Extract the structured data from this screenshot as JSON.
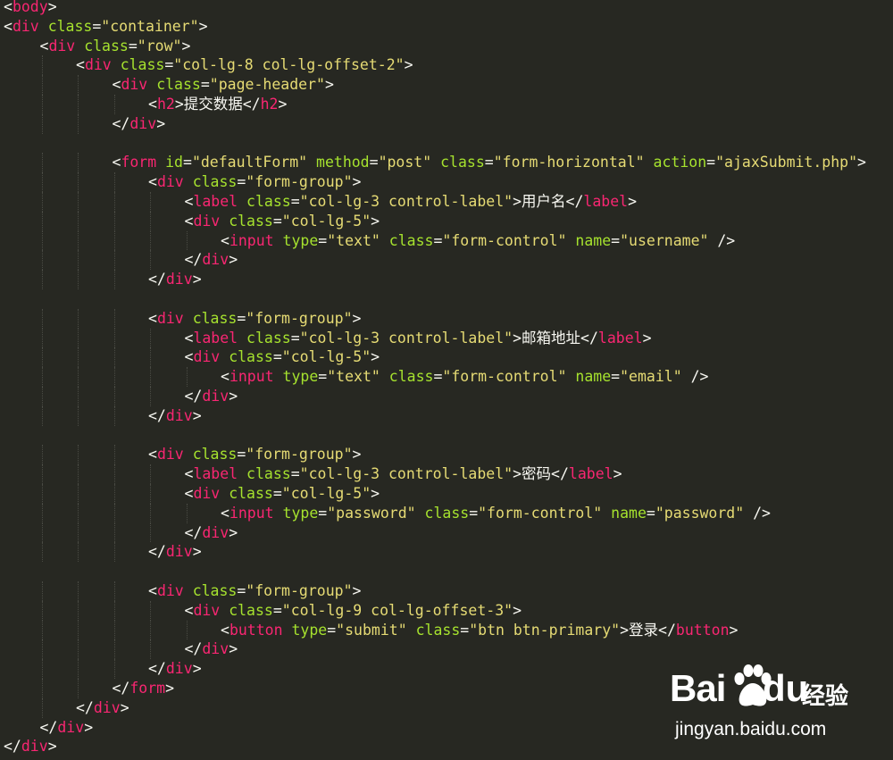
{
  "editor": {
    "theme": "monokai",
    "colors": {
      "background": "#272822",
      "tag": "#f92672",
      "attribute": "#a6e22e",
      "string": "#e6db74",
      "text": "#f8f8f2"
    },
    "lines": [
      {
        "indent": 0,
        "tokens": [
          [
            "p",
            "<"
          ],
          [
            "tag",
            "body"
          ],
          [
            "p",
            ">"
          ]
        ]
      },
      {
        "indent": 0,
        "tokens": [
          [
            "p",
            "<"
          ],
          [
            "tag",
            "div"
          ],
          [
            "p",
            " "
          ],
          [
            "attr",
            "class"
          ],
          [
            "p",
            "="
          ],
          [
            "str",
            "\"container\""
          ],
          [
            "p",
            ">"
          ]
        ]
      },
      {
        "indent": 1,
        "tokens": [
          [
            "p",
            "<"
          ],
          [
            "tag",
            "div"
          ],
          [
            "p",
            " "
          ],
          [
            "attr",
            "class"
          ],
          [
            "p",
            "="
          ],
          [
            "str",
            "\"row\""
          ],
          [
            "p",
            ">"
          ]
        ]
      },
      {
        "indent": 2,
        "tokens": [
          [
            "p",
            "<"
          ],
          [
            "tag",
            "div"
          ],
          [
            "p",
            " "
          ],
          [
            "attr",
            "class"
          ],
          [
            "p",
            "="
          ],
          [
            "str",
            "\"col-lg-8 col-lg-offset-2\""
          ],
          [
            "p",
            ">"
          ]
        ]
      },
      {
        "indent": 3,
        "tokens": [
          [
            "p",
            "<"
          ],
          [
            "tag",
            "div"
          ],
          [
            "p",
            " "
          ],
          [
            "attr",
            "class"
          ],
          [
            "p",
            "="
          ],
          [
            "str",
            "\"page-header\""
          ],
          [
            "p",
            ">"
          ]
        ]
      },
      {
        "indent": 4,
        "tokens": [
          [
            "p",
            "<"
          ],
          [
            "tag",
            "h2"
          ],
          [
            "p",
            ">"
          ],
          [
            "text",
            "提交数据"
          ],
          [
            "p",
            "</"
          ],
          [
            "tag",
            "h2"
          ],
          [
            "p",
            ">"
          ]
        ]
      },
      {
        "indent": 3,
        "tokens": [
          [
            "p",
            "</"
          ],
          [
            "tag",
            "div"
          ],
          [
            "p",
            ">"
          ]
        ]
      },
      {
        "indent": 0,
        "tokens": []
      },
      {
        "indent": 3,
        "tokens": [
          [
            "p",
            "<"
          ],
          [
            "tag",
            "form"
          ],
          [
            "p",
            " "
          ],
          [
            "attr",
            "id"
          ],
          [
            "p",
            "="
          ],
          [
            "str",
            "\"defaultForm\""
          ],
          [
            "p",
            " "
          ],
          [
            "attr",
            "method"
          ],
          [
            "p",
            "="
          ],
          [
            "str",
            "\"post\""
          ],
          [
            "p",
            " "
          ],
          [
            "attr",
            "class"
          ],
          [
            "p",
            "="
          ],
          [
            "str",
            "\"form-horizontal\""
          ],
          [
            "p",
            " "
          ],
          [
            "attr",
            "action"
          ],
          [
            "p",
            "="
          ],
          [
            "str",
            "\"ajaxSubmit.php\""
          ],
          [
            "p",
            ">"
          ]
        ]
      },
      {
        "indent": 4,
        "tokens": [
          [
            "p",
            "<"
          ],
          [
            "tag",
            "div"
          ],
          [
            "p",
            " "
          ],
          [
            "attr",
            "class"
          ],
          [
            "p",
            "="
          ],
          [
            "str",
            "\"form-group\""
          ],
          [
            "p",
            ">"
          ]
        ]
      },
      {
        "indent": 5,
        "tokens": [
          [
            "p",
            "<"
          ],
          [
            "tag",
            "label"
          ],
          [
            "p",
            " "
          ],
          [
            "attr",
            "class"
          ],
          [
            "p",
            "="
          ],
          [
            "str",
            "\"col-lg-3 control-label\""
          ],
          [
            "p",
            ">"
          ],
          [
            "text",
            "用户名"
          ],
          [
            "p",
            "</"
          ],
          [
            "tag",
            "label"
          ],
          [
            "p",
            ">"
          ]
        ]
      },
      {
        "indent": 5,
        "tokens": [
          [
            "p",
            "<"
          ],
          [
            "tag",
            "div"
          ],
          [
            "p",
            " "
          ],
          [
            "attr",
            "class"
          ],
          [
            "p",
            "="
          ],
          [
            "str",
            "\"col-lg-5\""
          ],
          [
            "p",
            ">"
          ]
        ]
      },
      {
        "indent": 6,
        "tokens": [
          [
            "p",
            "<"
          ],
          [
            "tag",
            "input"
          ],
          [
            "p",
            " "
          ],
          [
            "attr",
            "type"
          ],
          [
            "p",
            "="
          ],
          [
            "str",
            "\"text\""
          ],
          [
            "p",
            " "
          ],
          [
            "attr",
            "class"
          ],
          [
            "p",
            "="
          ],
          [
            "str",
            "\"form-control\""
          ],
          [
            "p",
            " "
          ],
          [
            "attr",
            "name"
          ],
          [
            "p",
            "="
          ],
          [
            "str",
            "\"username\""
          ],
          [
            "p",
            " />"
          ]
        ]
      },
      {
        "indent": 5,
        "tokens": [
          [
            "p",
            "</"
          ],
          [
            "tag",
            "div"
          ],
          [
            "p",
            ">"
          ]
        ]
      },
      {
        "indent": 4,
        "tokens": [
          [
            "p",
            "</"
          ],
          [
            "tag",
            "div"
          ],
          [
            "p",
            ">"
          ]
        ]
      },
      {
        "indent": 0,
        "tokens": []
      },
      {
        "indent": 4,
        "tokens": [
          [
            "p",
            "<"
          ],
          [
            "tag",
            "div"
          ],
          [
            "p",
            " "
          ],
          [
            "attr",
            "class"
          ],
          [
            "p",
            "="
          ],
          [
            "str",
            "\"form-group\""
          ],
          [
            "p",
            ">"
          ]
        ]
      },
      {
        "indent": 5,
        "tokens": [
          [
            "p",
            "<"
          ],
          [
            "tag",
            "label"
          ],
          [
            "p",
            " "
          ],
          [
            "attr",
            "class"
          ],
          [
            "p",
            "="
          ],
          [
            "str",
            "\"col-lg-3 control-label\""
          ],
          [
            "p",
            ">"
          ],
          [
            "text",
            "邮箱地址"
          ],
          [
            "p",
            "</"
          ],
          [
            "tag",
            "label"
          ],
          [
            "p",
            ">"
          ]
        ]
      },
      {
        "indent": 5,
        "tokens": [
          [
            "p",
            "<"
          ],
          [
            "tag",
            "div"
          ],
          [
            "p",
            " "
          ],
          [
            "attr",
            "class"
          ],
          [
            "p",
            "="
          ],
          [
            "str",
            "\"col-lg-5\""
          ],
          [
            "p",
            ">"
          ]
        ]
      },
      {
        "indent": 6,
        "tokens": [
          [
            "p",
            "<"
          ],
          [
            "tag",
            "input"
          ],
          [
            "p",
            " "
          ],
          [
            "attr",
            "type"
          ],
          [
            "p",
            "="
          ],
          [
            "str",
            "\"text\""
          ],
          [
            "p",
            " "
          ],
          [
            "attr",
            "class"
          ],
          [
            "p",
            "="
          ],
          [
            "str",
            "\"form-control\""
          ],
          [
            "p",
            " "
          ],
          [
            "attr",
            "name"
          ],
          [
            "p",
            "="
          ],
          [
            "str",
            "\"email\""
          ],
          [
            "p",
            " />"
          ]
        ]
      },
      {
        "indent": 5,
        "tokens": [
          [
            "p",
            "</"
          ],
          [
            "tag",
            "div"
          ],
          [
            "p",
            ">"
          ]
        ]
      },
      {
        "indent": 4,
        "tokens": [
          [
            "p",
            "</"
          ],
          [
            "tag",
            "div"
          ],
          [
            "p",
            ">"
          ]
        ]
      },
      {
        "indent": 0,
        "tokens": []
      },
      {
        "indent": 4,
        "tokens": [
          [
            "p",
            "<"
          ],
          [
            "tag",
            "div"
          ],
          [
            "p",
            " "
          ],
          [
            "attr",
            "class"
          ],
          [
            "p",
            "="
          ],
          [
            "str",
            "\"form-group\""
          ],
          [
            "p",
            ">"
          ]
        ]
      },
      {
        "indent": 5,
        "tokens": [
          [
            "p",
            "<"
          ],
          [
            "tag",
            "label"
          ],
          [
            "p",
            " "
          ],
          [
            "attr",
            "class"
          ],
          [
            "p",
            "="
          ],
          [
            "str",
            "\"col-lg-3 control-label\""
          ],
          [
            "p",
            ">"
          ],
          [
            "text",
            "密码"
          ],
          [
            "p",
            "</"
          ],
          [
            "tag",
            "label"
          ],
          [
            "p",
            ">"
          ]
        ]
      },
      {
        "indent": 5,
        "tokens": [
          [
            "p",
            "<"
          ],
          [
            "tag",
            "div"
          ],
          [
            "p",
            " "
          ],
          [
            "attr",
            "class"
          ],
          [
            "p",
            "="
          ],
          [
            "str",
            "\"col-lg-5\""
          ],
          [
            "p",
            ">"
          ]
        ]
      },
      {
        "indent": 6,
        "tokens": [
          [
            "p",
            "<"
          ],
          [
            "tag",
            "input"
          ],
          [
            "p",
            " "
          ],
          [
            "attr",
            "type"
          ],
          [
            "p",
            "="
          ],
          [
            "str",
            "\"password\""
          ],
          [
            "p",
            " "
          ],
          [
            "attr",
            "class"
          ],
          [
            "p",
            "="
          ],
          [
            "str",
            "\"form-control\""
          ],
          [
            "p",
            " "
          ],
          [
            "attr",
            "name"
          ],
          [
            "p",
            "="
          ],
          [
            "str",
            "\"password\""
          ],
          [
            "p",
            " />"
          ]
        ]
      },
      {
        "indent": 5,
        "tokens": [
          [
            "p",
            "</"
          ],
          [
            "tag",
            "div"
          ],
          [
            "p",
            ">"
          ]
        ]
      },
      {
        "indent": 4,
        "tokens": [
          [
            "p",
            "</"
          ],
          [
            "tag",
            "div"
          ],
          [
            "p",
            ">"
          ]
        ]
      },
      {
        "indent": 0,
        "tokens": []
      },
      {
        "indent": 4,
        "tokens": [
          [
            "p",
            "<"
          ],
          [
            "tag",
            "div"
          ],
          [
            "p",
            " "
          ],
          [
            "attr",
            "class"
          ],
          [
            "p",
            "="
          ],
          [
            "str",
            "\"form-group\""
          ],
          [
            "p",
            ">"
          ]
        ]
      },
      {
        "indent": 5,
        "tokens": [
          [
            "p",
            "<"
          ],
          [
            "tag",
            "div"
          ],
          [
            "p",
            " "
          ],
          [
            "attr",
            "class"
          ],
          [
            "p",
            "="
          ],
          [
            "str",
            "\"col-lg-9 col-lg-offset-3\""
          ],
          [
            "p",
            ">"
          ]
        ]
      },
      {
        "indent": 6,
        "tokens": [
          [
            "p",
            "<"
          ],
          [
            "tag",
            "button"
          ],
          [
            "p",
            " "
          ],
          [
            "attr",
            "type"
          ],
          [
            "p",
            "="
          ],
          [
            "str",
            "\"submit\""
          ],
          [
            "p",
            " "
          ],
          [
            "attr",
            "class"
          ],
          [
            "p",
            "="
          ],
          [
            "str",
            "\"btn btn-primary\""
          ],
          [
            "p",
            ">"
          ],
          [
            "text",
            "登录"
          ],
          [
            "p",
            "</"
          ],
          [
            "tag",
            "button"
          ],
          [
            "p",
            ">"
          ]
        ]
      },
      {
        "indent": 5,
        "tokens": [
          [
            "p",
            "</"
          ],
          [
            "tag",
            "div"
          ],
          [
            "p",
            ">"
          ]
        ]
      },
      {
        "indent": 4,
        "tokens": [
          [
            "p",
            "</"
          ],
          [
            "tag",
            "div"
          ],
          [
            "p",
            ">"
          ]
        ]
      },
      {
        "indent": 3,
        "tokens": [
          [
            "p",
            "</"
          ],
          [
            "tag",
            "form"
          ],
          [
            "p",
            ">"
          ]
        ]
      },
      {
        "indent": 2,
        "tokens": [
          [
            "p",
            "</"
          ],
          [
            "tag",
            "div"
          ],
          [
            "p",
            ">"
          ]
        ]
      },
      {
        "indent": 1,
        "tokens": [
          [
            "p",
            "</"
          ],
          [
            "tag",
            "div"
          ],
          [
            "p",
            ">"
          ]
        ]
      },
      {
        "indent": 0,
        "tokens": [
          [
            "p",
            "</"
          ],
          [
            "tag",
            "div"
          ],
          [
            "p",
            ">"
          ]
        ]
      }
    ]
  },
  "watermark": {
    "brand_left": "Bai",
    "brand_right": "du",
    "brand_product": "经验",
    "url": "jingyan.baidu.com",
    "paw_icon": "baidu-paw-icon"
  }
}
